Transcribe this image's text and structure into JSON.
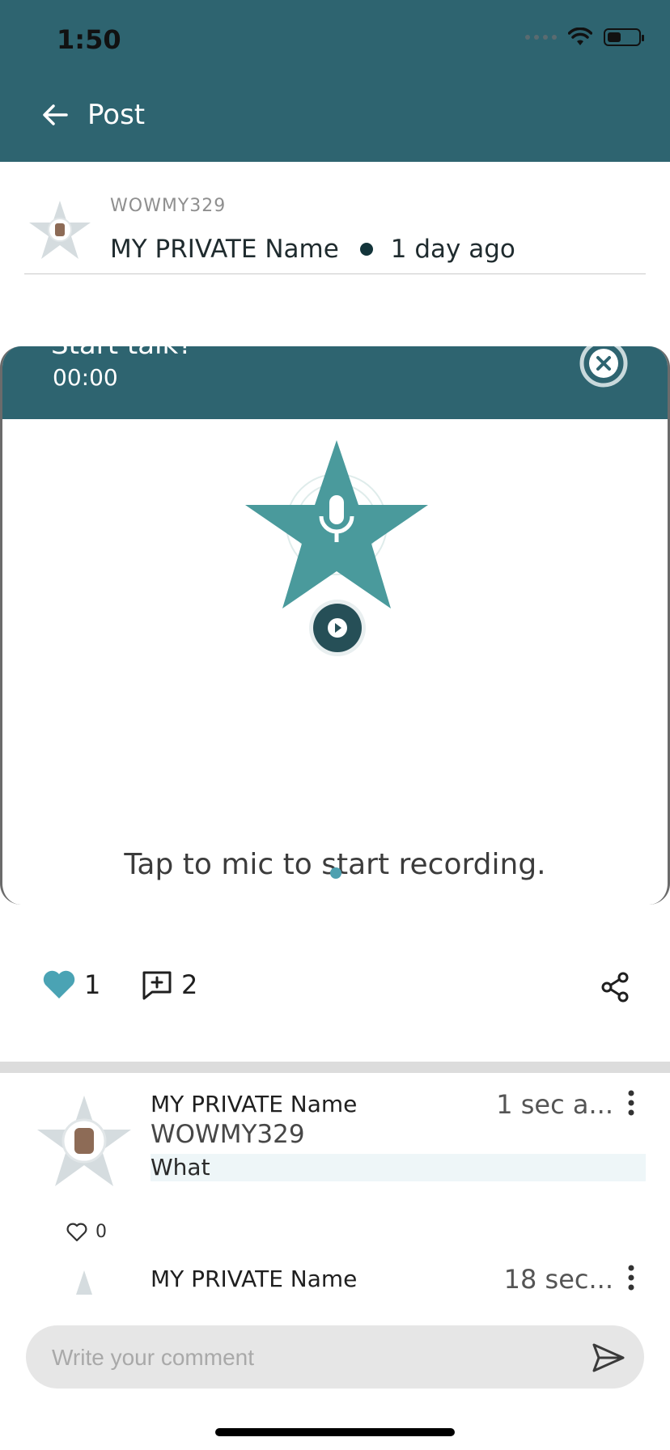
{
  "status_bar": {
    "time": "1:50",
    "battery_level": 0.45
  },
  "header": {
    "title": "Post",
    "background_color": "#2e6470"
  },
  "post": {
    "username": "WOWMY329",
    "display_name": "MY PRIVATE Name",
    "time_ago": "1 day ago"
  },
  "media": {
    "title_partial": "Start talk?",
    "timer": "00:00",
    "hint": "Tap to mic to start recording.",
    "accent_color": "#4a9a9c"
  },
  "actions": {
    "likes": "1",
    "comments": "2",
    "like_color": "#4aa3b4"
  },
  "comments": [
    {
      "display_name": "MY PRIVATE Name",
      "username": "WOWMY329",
      "text": "What",
      "time": "1 sec a...",
      "likes": "0"
    },
    {
      "display_name": "MY PRIVATE Name",
      "time": "18 sec..."
    }
  ],
  "composer": {
    "placeholder": "Write your comment"
  }
}
